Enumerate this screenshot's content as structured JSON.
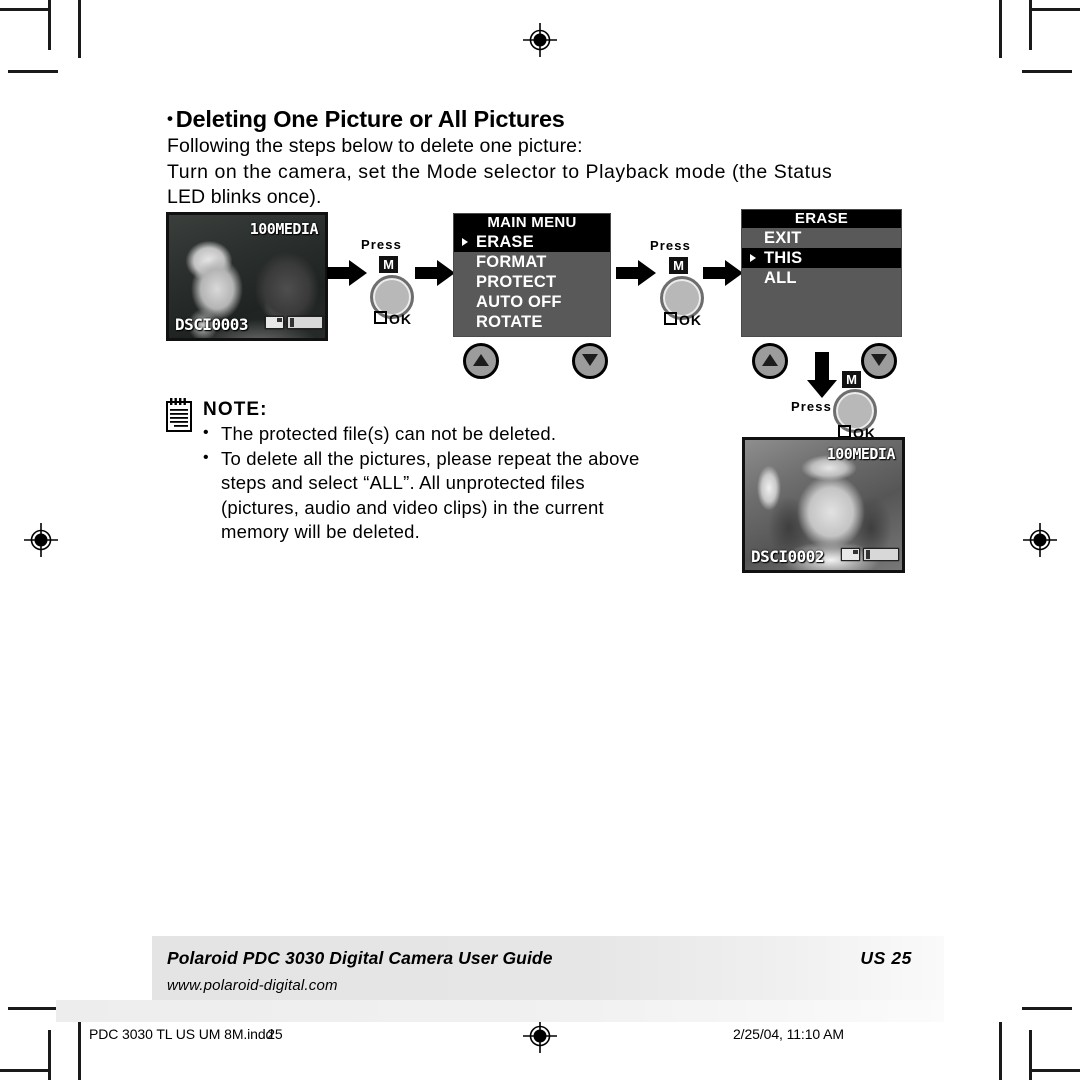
{
  "document": {
    "heading_bullet": "•",
    "heading": "Deleting One Picture or All Pictures",
    "intro_line1": "Following the steps below to delete one picture:",
    "intro_line2": "Turn on the camera, set the Mode selector to Playback mode (the Status",
    "intro_line3": "LED blinks once)."
  },
  "step1_lcd": {
    "folder": "100MEDIA",
    "filename": "DSCI0003",
    "card_icon": "memory-card-icon",
    "battery_icon": "battery-icon"
  },
  "result_lcd": {
    "folder": "100MEDIA",
    "filename": "DSCI0002",
    "card_icon": "memory-card-icon",
    "battery_icon": "battery-icon"
  },
  "main_menu": {
    "title": "MAIN MENU",
    "items": [
      {
        "label": "ERASE",
        "selected": true
      },
      {
        "label": "FORMAT",
        "selected": false
      },
      {
        "label": "PROTECT",
        "selected": false
      },
      {
        "label": "AUTO OFF",
        "selected": false
      },
      {
        "label": "ROTATE",
        "selected": false
      }
    ]
  },
  "erase_menu": {
    "title": "ERASE",
    "items": [
      {
        "label": "EXIT",
        "selected": false
      },
      {
        "label": "THIS",
        "selected": true
      },
      {
        "label": "ALL",
        "selected": false
      }
    ]
  },
  "buttons": {
    "press_label_1": "Press",
    "press_label_2": "Press",
    "press_label_3": "Press",
    "m_badge": "M",
    "ok_label": "OK",
    "up_icon": "triangle-up-icon",
    "down_icon": "triangle-down-icon",
    "arrow_icon": "block-arrow-right-icon",
    "arrow_down_icon": "block-arrow-down-icon"
  },
  "note": {
    "icon": "notepad-icon",
    "title": "NOTE:",
    "items": [
      "The protected file(s) can not be deleted.",
      "To delete all the pictures, please repeat the above steps and select “ALL”. All unprotected files (pictures, audio and video clips) in the current memory will be deleted."
    ],
    "item2_lines": [
      "To delete all the pictures, please repeat the above",
      "steps and select “ALL”. All unprotected files",
      "(pictures, audio and video clips) in the current",
      "memory will be deleted."
    ]
  },
  "footer": {
    "title": "Polaroid PDC 3030 Digital Camera User Guide",
    "page": "US 25",
    "url": "www.polaroid-digital.com",
    "print_file": "PDC 3030 TL US UM 8M.indd",
    "print_page": "25",
    "print_date": "2/25/04, 11:10 AM",
    "registration_icon": "registration-mark-icon"
  },
  "colors": {
    "menu_bg": "#595959",
    "menu_title_bg": "#000000",
    "selected_bg": "#000000",
    "button_face": "#b8b8b8",
    "footer_band": "#e6e6e6"
  }
}
